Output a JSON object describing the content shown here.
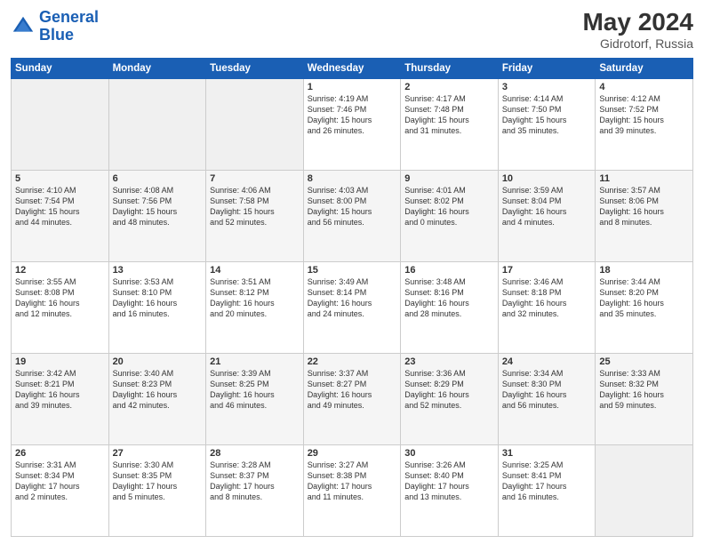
{
  "header": {
    "logo_line1": "General",
    "logo_line2": "Blue",
    "month_year": "May 2024",
    "location": "Gidrotorf, Russia"
  },
  "days_of_week": [
    "Sunday",
    "Monday",
    "Tuesday",
    "Wednesday",
    "Thursday",
    "Friday",
    "Saturday"
  ],
  "weeks": [
    [
      {
        "day": "",
        "info": ""
      },
      {
        "day": "",
        "info": ""
      },
      {
        "day": "",
        "info": ""
      },
      {
        "day": "1",
        "info": "Sunrise: 4:19 AM\nSunset: 7:46 PM\nDaylight: 15 hours\nand 26 minutes."
      },
      {
        "day": "2",
        "info": "Sunrise: 4:17 AM\nSunset: 7:48 PM\nDaylight: 15 hours\nand 31 minutes."
      },
      {
        "day": "3",
        "info": "Sunrise: 4:14 AM\nSunset: 7:50 PM\nDaylight: 15 hours\nand 35 minutes."
      },
      {
        "day": "4",
        "info": "Sunrise: 4:12 AM\nSunset: 7:52 PM\nDaylight: 15 hours\nand 39 minutes."
      }
    ],
    [
      {
        "day": "5",
        "info": "Sunrise: 4:10 AM\nSunset: 7:54 PM\nDaylight: 15 hours\nand 44 minutes."
      },
      {
        "day": "6",
        "info": "Sunrise: 4:08 AM\nSunset: 7:56 PM\nDaylight: 15 hours\nand 48 minutes."
      },
      {
        "day": "7",
        "info": "Sunrise: 4:06 AM\nSunset: 7:58 PM\nDaylight: 15 hours\nand 52 minutes."
      },
      {
        "day": "8",
        "info": "Sunrise: 4:03 AM\nSunset: 8:00 PM\nDaylight: 15 hours\nand 56 minutes."
      },
      {
        "day": "9",
        "info": "Sunrise: 4:01 AM\nSunset: 8:02 PM\nDaylight: 16 hours\nand 0 minutes."
      },
      {
        "day": "10",
        "info": "Sunrise: 3:59 AM\nSunset: 8:04 PM\nDaylight: 16 hours\nand 4 minutes."
      },
      {
        "day": "11",
        "info": "Sunrise: 3:57 AM\nSunset: 8:06 PM\nDaylight: 16 hours\nand 8 minutes."
      }
    ],
    [
      {
        "day": "12",
        "info": "Sunrise: 3:55 AM\nSunset: 8:08 PM\nDaylight: 16 hours\nand 12 minutes."
      },
      {
        "day": "13",
        "info": "Sunrise: 3:53 AM\nSunset: 8:10 PM\nDaylight: 16 hours\nand 16 minutes."
      },
      {
        "day": "14",
        "info": "Sunrise: 3:51 AM\nSunset: 8:12 PM\nDaylight: 16 hours\nand 20 minutes."
      },
      {
        "day": "15",
        "info": "Sunrise: 3:49 AM\nSunset: 8:14 PM\nDaylight: 16 hours\nand 24 minutes."
      },
      {
        "day": "16",
        "info": "Sunrise: 3:48 AM\nSunset: 8:16 PM\nDaylight: 16 hours\nand 28 minutes."
      },
      {
        "day": "17",
        "info": "Sunrise: 3:46 AM\nSunset: 8:18 PM\nDaylight: 16 hours\nand 32 minutes."
      },
      {
        "day": "18",
        "info": "Sunrise: 3:44 AM\nSunset: 8:20 PM\nDaylight: 16 hours\nand 35 minutes."
      }
    ],
    [
      {
        "day": "19",
        "info": "Sunrise: 3:42 AM\nSunset: 8:21 PM\nDaylight: 16 hours\nand 39 minutes."
      },
      {
        "day": "20",
        "info": "Sunrise: 3:40 AM\nSunset: 8:23 PM\nDaylight: 16 hours\nand 42 minutes."
      },
      {
        "day": "21",
        "info": "Sunrise: 3:39 AM\nSunset: 8:25 PM\nDaylight: 16 hours\nand 46 minutes."
      },
      {
        "day": "22",
        "info": "Sunrise: 3:37 AM\nSunset: 8:27 PM\nDaylight: 16 hours\nand 49 minutes."
      },
      {
        "day": "23",
        "info": "Sunrise: 3:36 AM\nSunset: 8:29 PM\nDaylight: 16 hours\nand 52 minutes."
      },
      {
        "day": "24",
        "info": "Sunrise: 3:34 AM\nSunset: 8:30 PM\nDaylight: 16 hours\nand 56 minutes."
      },
      {
        "day": "25",
        "info": "Sunrise: 3:33 AM\nSunset: 8:32 PM\nDaylight: 16 hours\nand 59 minutes."
      }
    ],
    [
      {
        "day": "26",
        "info": "Sunrise: 3:31 AM\nSunset: 8:34 PM\nDaylight: 17 hours\nand 2 minutes."
      },
      {
        "day": "27",
        "info": "Sunrise: 3:30 AM\nSunset: 8:35 PM\nDaylight: 17 hours\nand 5 minutes."
      },
      {
        "day": "28",
        "info": "Sunrise: 3:28 AM\nSunset: 8:37 PM\nDaylight: 17 hours\nand 8 minutes."
      },
      {
        "day": "29",
        "info": "Sunrise: 3:27 AM\nSunset: 8:38 PM\nDaylight: 17 hours\nand 11 minutes."
      },
      {
        "day": "30",
        "info": "Sunrise: 3:26 AM\nSunset: 8:40 PM\nDaylight: 17 hours\nand 13 minutes."
      },
      {
        "day": "31",
        "info": "Sunrise: 3:25 AM\nSunset: 8:41 PM\nDaylight: 17 hours\nand 16 minutes."
      },
      {
        "day": "",
        "info": ""
      }
    ]
  ]
}
